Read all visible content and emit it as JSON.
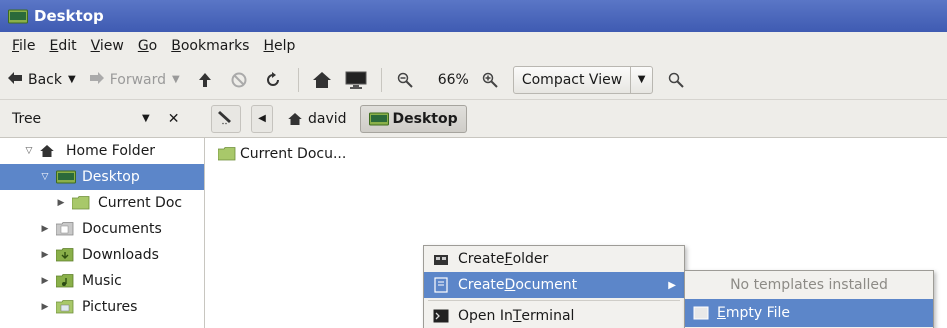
{
  "window": {
    "title": "Desktop",
    "title_bar_color": "#4863b9"
  },
  "menubar": {
    "items": [
      {
        "accel": "F",
        "rest": "ile"
      },
      {
        "accel": "E",
        "rest": "dit"
      },
      {
        "accel": "V",
        "rest": "iew"
      },
      {
        "accel": "G",
        "rest": "o"
      },
      {
        "accel": "B",
        "rest": "ookmarks"
      },
      {
        "accel": "H",
        "rest": "elp"
      }
    ]
  },
  "toolbar": {
    "back_label": "Back",
    "forward_label": "Forward",
    "zoom_level": "66%",
    "view_mode": "Compact View",
    "icons": [
      "back-arrow-icon",
      "forward-arrow-icon",
      "up-arrow-icon",
      "stop-icon",
      "reload-icon",
      "home-icon",
      "computer-icon",
      "zoom-out-icon",
      "zoom-in-icon",
      "search-icon"
    ]
  },
  "location_bar": {
    "side_pane_mode": "Tree",
    "breadcrumbs": [
      {
        "label": "david",
        "icon": "home-icon"
      },
      {
        "label": "Desktop",
        "icon": "desktop-folder-icon",
        "active": true
      }
    ]
  },
  "sidebar": {
    "tree": [
      {
        "label": "Home Folder",
        "icon": "home-icon",
        "level": 0,
        "expanded": true
      },
      {
        "label": "Desktop",
        "icon": "desktop-folder-icon",
        "level": 1,
        "expanded": true,
        "selected": true
      },
      {
        "label": "Current Doc",
        "icon": "folder-icon",
        "level": 2
      },
      {
        "label": "Documents",
        "icon": "documents-folder-icon",
        "level": 1
      },
      {
        "label": "Downloads",
        "icon": "downloads-folder-icon",
        "level": 1
      },
      {
        "label": "Music",
        "icon": "music-folder-icon",
        "level": 1
      },
      {
        "label": "Pictures",
        "icon": "pictures-folder-icon",
        "level": 1
      }
    ]
  },
  "content": {
    "files": [
      {
        "label": "Current Docu...",
        "icon": "folder-icon"
      }
    ]
  },
  "context_menu": {
    "items": [
      {
        "pre": "Create ",
        "accel": "F",
        "rest": "older",
        "icon": "new-folder-icon"
      },
      {
        "pre": "Create ",
        "accel": "D",
        "rest": "ocument",
        "icon": "new-document-icon",
        "highlighted": true,
        "has_submenu": true
      },
      {
        "pre": "Open In ",
        "accel": "T",
        "rest": "erminal",
        "icon": "terminal-icon"
      }
    ]
  },
  "submenu": {
    "items": [
      {
        "label": "No templates installed",
        "disabled": true
      },
      {
        "accel": "E",
        "rest": "mpty File",
        "icon": "empty-file-icon",
        "highlighted": true
      }
    ]
  },
  "colors": {
    "selection": "#5c86c9",
    "folder_green": "#8ab04a"
  }
}
